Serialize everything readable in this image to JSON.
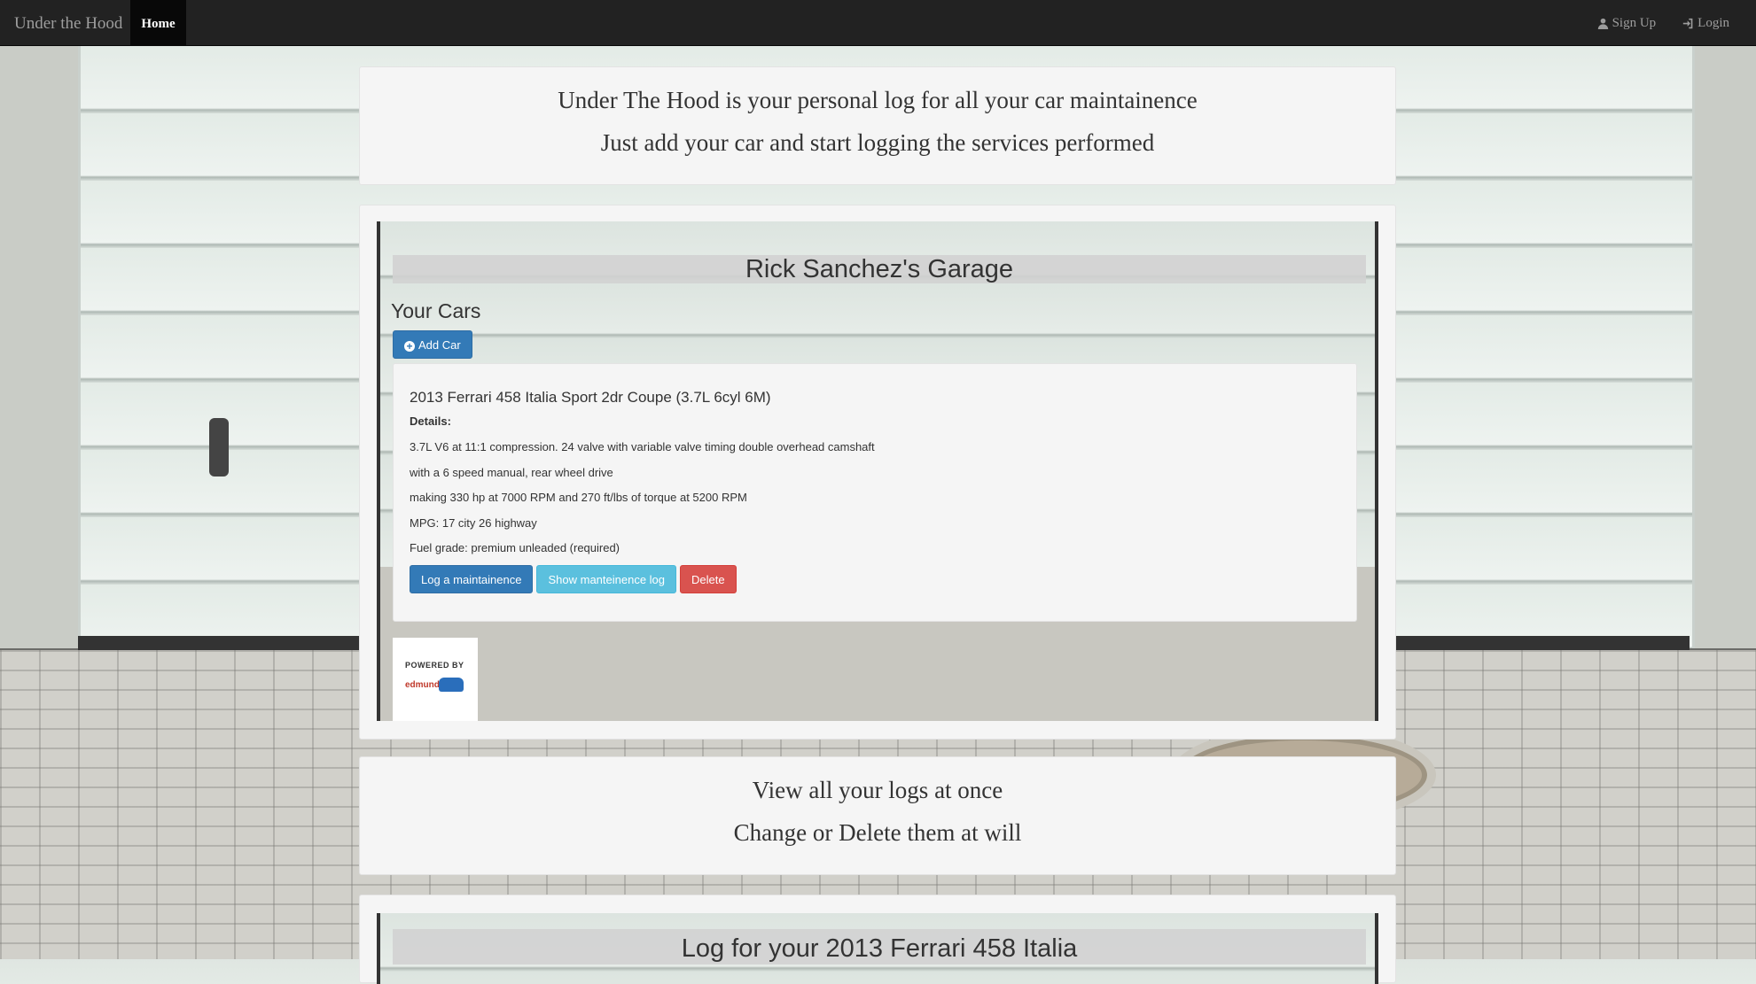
{
  "navbar": {
    "brand": "Under the Hood",
    "home": "Home",
    "signup": "Sign Up",
    "login": "Login"
  },
  "hero": {
    "line1": "Under The Hood is your personal log for all your car maintainence",
    "line2": "Just add your car and start logging the services performed"
  },
  "garage": {
    "title": "Rick Sanchez's Garage",
    "your_cars": "Your Cars",
    "add_car": "Add Car",
    "car": {
      "title": "2013 Ferrari 458 Italia Sport 2dr Coupe (3.7L 6cyl 6M)",
      "details_label": "Details:",
      "details": [
        "3.7L V6 at 11:1 compression. 24 valve with variable valve timing double overhead camshaft",
        "with a 6 speed manual, rear wheel drive",
        "making 330 hp at 7000 RPM and 270 ft/lbs of torque at 5200 RPM",
        "MPG: 17 city 26 highway",
        "Fuel grade: premium unleaded (required)"
      ],
      "buttons": {
        "log": "Log a maintainence",
        "show": "Show manteinence log",
        "delete": "Delete"
      }
    },
    "powered_by": "POWERED BY",
    "edmunds": "edmunds"
  },
  "logs_info": {
    "line1": "View all your logs at once",
    "line2": "Change or Delete them at will"
  },
  "log_section": {
    "title": "Log for your 2013 Ferrari 458 Italia"
  },
  "colors": {
    "navbar": "#222222",
    "primary": "#337ab7",
    "info": "#5bc0de",
    "danger": "#d9534f",
    "panel": "#f5f5f5"
  }
}
